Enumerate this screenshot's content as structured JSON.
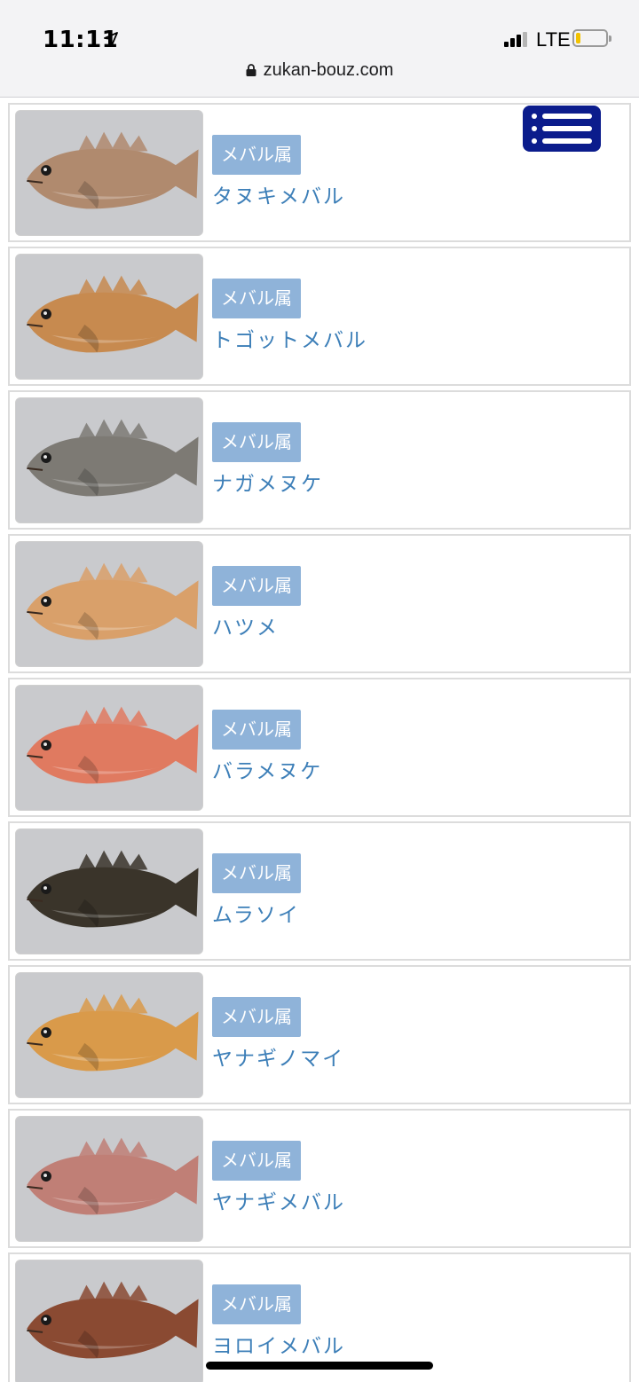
{
  "status_bar": {
    "time": "11:11",
    "carrier": "LTE",
    "location_icon": "location-arrow-icon",
    "signal_icon": "signal-icon",
    "battery_icon": "battery-icon"
  },
  "browser": {
    "url": "zukan-bouz.com",
    "lock_icon": "lock-icon"
  },
  "menu_button": {
    "icon": "hamburger-list-icon",
    "color": "#0b1c8c"
  },
  "colors": {
    "genus_badge_bg": "#8fb3d9",
    "species_link": "#3d7fb8"
  },
  "fish_list": [
    {
      "genus": "メバル属",
      "name": "タヌキメバル",
      "color": "#b08a6e"
    },
    {
      "genus": "メバル属",
      "name": "トゴットメバル",
      "color": "#c78a4f"
    },
    {
      "genus": "メバル属",
      "name": "ナガメヌケ",
      "color": "#7d7a74"
    },
    {
      "genus": "メバル属",
      "name": "ハツメ",
      "color": "#d9a06a"
    },
    {
      "genus": "メバル属",
      "name": "バラメヌケ",
      "color": "#e07a60"
    },
    {
      "genus": "メバル属",
      "name": "ムラソイ",
      "color": "#3a342a"
    },
    {
      "genus": "メバル属",
      "name": "ヤナギノマイ",
      "color": "#d99a4a"
    },
    {
      "genus": "メバル属",
      "name": "ヤナギメバル",
      "color": "#c07f76"
    },
    {
      "genus": "メバル属",
      "name": "ヨロイメバル",
      "color": "#8a4a32"
    }
  ]
}
